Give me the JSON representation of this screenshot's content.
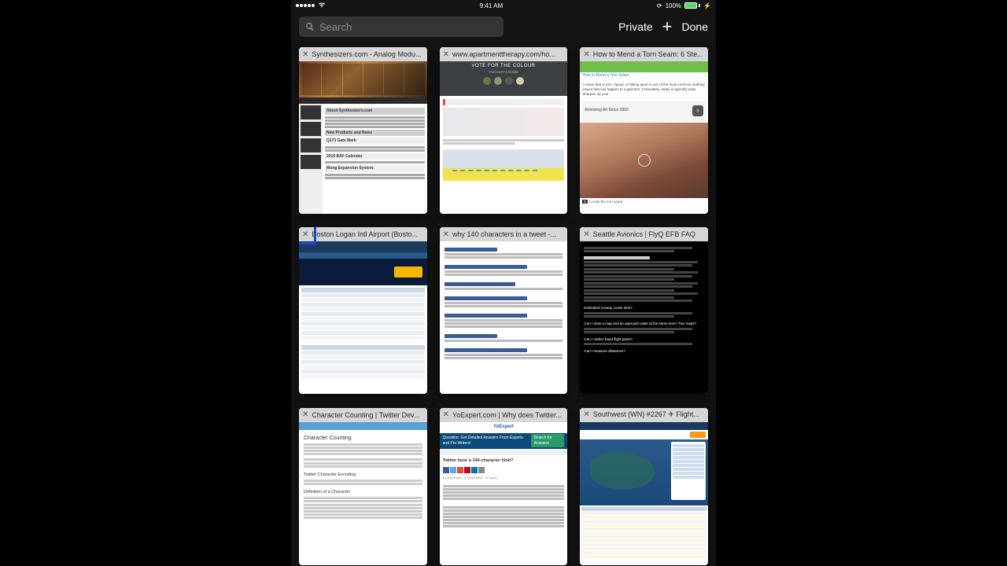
{
  "status": {
    "time": "9:41 AM",
    "battery_pct": "100%",
    "lock": "⦿"
  },
  "toolbar": {
    "search_placeholder": "Search",
    "private_label": "Private",
    "done_label": "Done"
  },
  "tabs": [
    {
      "title": "Synthesizers.com - Analog Modu..."
    },
    {
      "title": "www.apartmenttherapy.com/ho..."
    },
    {
      "title": "How to Mend a Torn Seam: 6 Ste..."
    },
    {
      "title": "Boston Logan Intl Airport (Bosto..."
    },
    {
      "title": "why 140 characters in a tweet -..."
    },
    {
      "title": "Seattle Avionics | FlyQ EFB FAQ"
    },
    {
      "title": "Character Counting | Twitter Dev..."
    },
    {
      "title": "YoExpert.com | Why does Twitter..."
    },
    {
      "title": "Southwest (WN) #2267 ✈ Flight..."
    }
  ],
  "thumb": {
    "apt": {
      "vote_title": "VOTE FOR THE COLOUR",
      "vote_sub": "FOR KATY'S ROOM"
    },
    "mend": {
      "crumb": "How to Mend a Torn Seam",
      "lead": "A seam that is torn, ripped, or falling apart is one of the most common clothing issues that can happen to a garment. Fortunately, repair is typically easy. Sharpen up your",
      "ad": "Restoring Art Since 1850",
      "step": "Locate the torn seam."
    },
    "synth": {
      "h1": "About Synthesizers.com",
      "h2": "New Products and News",
      "h3": "Q173 Gate Math",
      "h4": "2016 BAF Calendar",
      "h5": "Moog Expansion System:"
    },
    "faq": {
      "q1": "Estimated runway cruise time?",
      "q2": "Can I draw a map and an approach plate at the same time? Two maps?",
      "q3": "Can I rubber-band flight plans?",
      "q4": "Can I measure distances?"
    },
    "charcount": {
      "h1": "Character Counting",
      "h2": "Twitter Character Encoding",
      "h3": "Definition of a Character"
    },
    "yo": {
      "logo": "YoExpert",
      "bar": "Question: Get Detailed Answers From Experts and Pro Writers!",
      "btn": "Search for Answers",
      "q": "Twitter have a 140-character limit?"
    }
  }
}
